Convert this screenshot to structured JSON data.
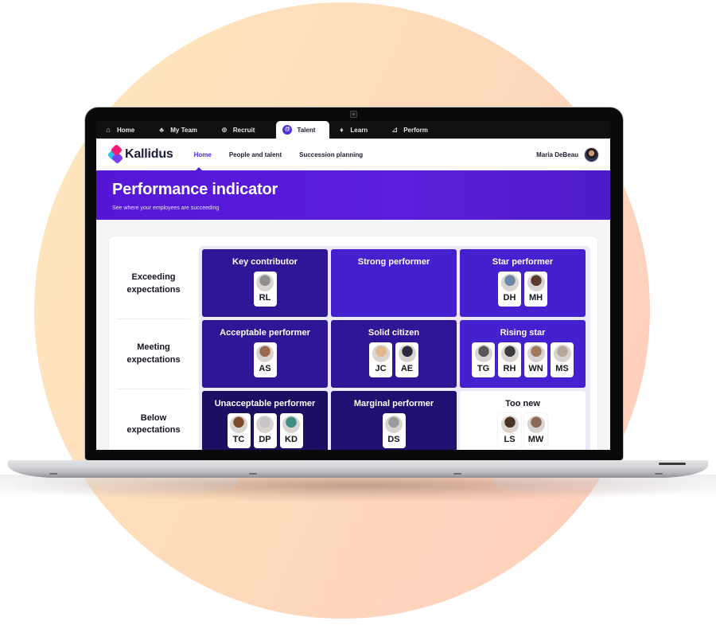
{
  "app_tabs": [
    {
      "label": "Home",
      "icon": "home-icon",
      "glyph": "⌂",
      "active": false
    },
    {
      "label": "My Team",
      "icon": "org-chart-icon",
      "glyph": "♣",
      "active": false
    },
    {
      "label": "Recruit",
      "icon": "recruit-icon",
      "glyph": "⊕",
      "active": false
    },
    {
      "label": "Talent",
      "icon": "talent-icon",
      "glyph": "@",
      "active": true
    },
    {
      "label": "Learn",
      "icon": "graduation-cap-icon",
      "glyph": "♦",
      "active": false
    },
    {
      "label": "Perform",
      "icon": "chart-icon",
      "glyph": "⊿",
      "active": false
    }
  ],
  "nav": {
    "brand": "Kallidus",
    "links": [
      {
        "label": "Home",
        "active": true
      },
      {
        "label": "People and talent",
        "active": false
      },
      {
        "label": "Succession planning",
        "active": false
      }
    ],
    "user_name": "Maria DeBeau"
  },
  "header": {
    "title": "Performance indicator",
    "subtitle": "See where your employees are succeeding"
  },
  "colors": {
    "brand_purple": "#5516d8",
    "accent_link": "#4a2ad8",
    "cell_dark": "#2e1697",
    "cell_bright": "#4420ce",
    "cell_deep": "#1e0e63",
    "background_circle": "#fedcbb"
  },
  "matrix": {
    "row_labels": [
      "Exceeding expectations",
      "Meeting expectations",
      "Below expectations"
    ],
    "cells": [
      {
        "title": "Key contributor",
        "people": [
          {
            "initials": "RL",
            "tone": "#8f8f8f"
          }
        ]
      },
      {
        "title": "Strong performer",
        "people": []
      },
      {
        "title": "Star performer",
        "people": [
          {
            "initials": "DH",
            "tone": "#6b86a6"
          },
          {
            "initials": "MH",
            "tone": "#5a3a2a"
          }
        ]
      },
      {
        "title": "Acceptable performer",
        "people": [
          {
            "initials": "AS",
            "tone": "#9b6a4e"
          }
        ]
      },
      {
        "title": "Solid citizen",
        "people": [
          {
            "initials": "JC",
            "tone": "#e3b98c"
          },
          {
            "initials": "AE",
            "tone": "#2c2c3a"
          }
        ]
      },
      {
        "title": "Rising star",
        "people": [
          {
            "initials": "TG",
            "tone": "#585858"
          },
          {
            "initials": "RH",
            "tone": "#3c3c3c"
          },
          {
            "initials": "WN",
            "tone": "#a07a5c"
          },
          {
            "initials": "MS",
            "tone": "#b8a89c"
          }
        ]
      },
      {
        "title": "Unacceptable performer",
        "people": [
          {
            "initials": "TC",
            "tone": "#7a4a2a"
          },
          {
            "initials": "DP",
            "tone": "#c9c3cc"
          },
          {
            "initials": "KD",
            "tone": "#3f8f86"
          }
        ]
      },
      {
        "title": "Marginal performer",
        "people": [
          {
            "initials": "DS",
            "tone": "#9a9a9a"
          }
        ]
      },
      {
        "title": "Too new",
        "people": [
          {
            "initials": "LS",
            "tone": "#4a3226"
          },
          {
            "initials": "MW",
            "tone": "#8a6a56"
          }
        ]
      }
    ]
  }
}
